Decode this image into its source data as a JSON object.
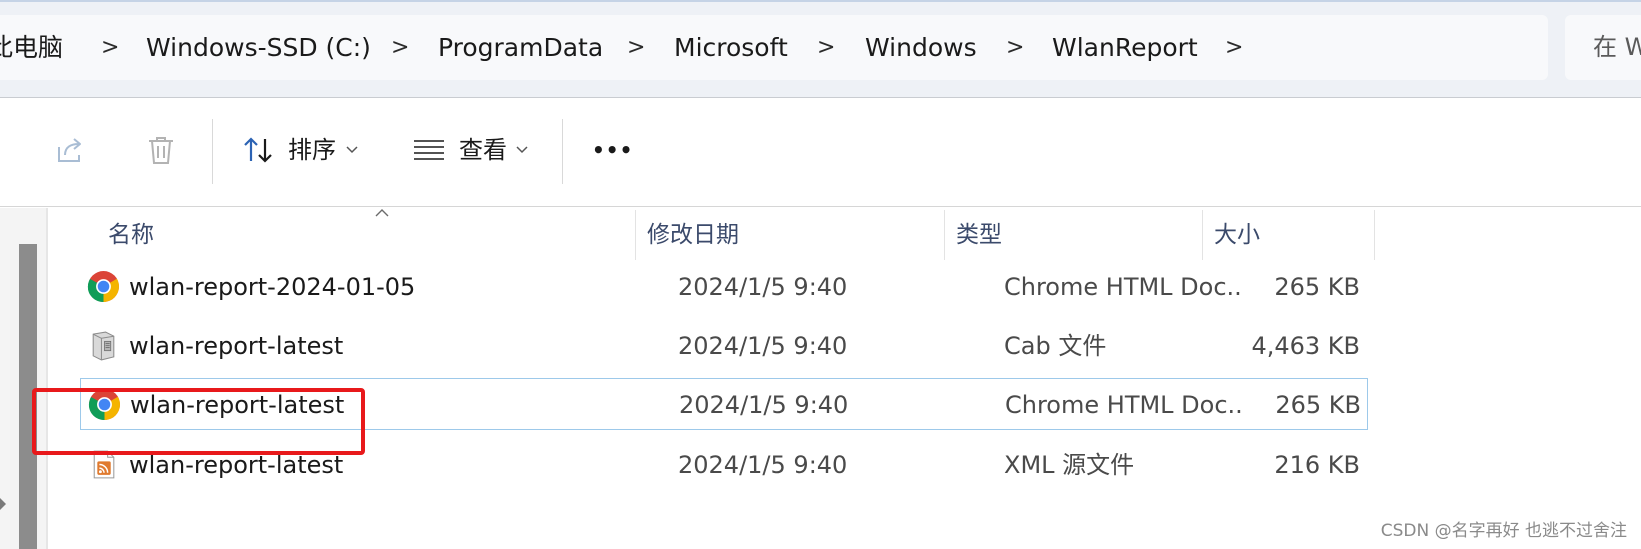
{
  "breadcrumb": {
    "items": [
      "此电脑",
      "Windows-SSD (C:)",
      "ProgramData",
      "Microsoft",
      "Windows",
      "WlanReport"
    ],
    "separator": ">"
  },
  "search": {
    "text": "在 W"
  },
  "toolbar": {
    "sort_label": "排序",
    "view_label": "查看",
    "more_label": "•••"
  },
  "columns": {
    "name": "名称",
    "date": "修改日期",
    "type": "类型",
    "size": "大小"
  },
  "files": [
    {
      "name": "wlan-report-2024-01-05",
      "date": "2024/1/5 9:40",
      "type": "Chrome HTML Doc...",
      "size": "265 KB",
      "icon": "chrome-icon"
    },
    {
      "name": "wlan-report-latest",
      "date": "2024/1/5 9:40",
      "type": "Cab 文件",
      "size": "4,463 KB",
      "icon": "cab-file-icon"
    },
    {
      "name": "wlan-report-latest",
      "date": "2024/1/5 9:40",
      "type": "Chrome HTML Doc...",
      "size": "265 KB",
      "icon": "chrome-icon"
    },
    {
      "name": "wlan-report-latest",
      "date": "2024/1/5 9:40",
      "type": "XML 源文件",
      "size": "216 KB",
      "icon": "xml-feed-icon"
    }
  ],
  "selected_file_index": 2,
  "colors": {
    "address_bg": "#eef1f6",
    "selection_border": "#9dc9ea",
    "annotation_red": "#e8191b",
    "header_text": "#3b4a6b"
  },
  "watermark": "CSDN @名字再好 也逃不过舍注"
}
